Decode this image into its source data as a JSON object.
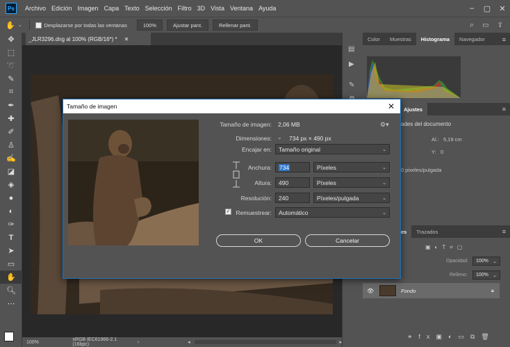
{
  "menubar": {
    "items": [
      "Archivo",
      "Edición",
      "Imagen",
      "Capa",
      "Texto",
      "Selección",
      "Filtro",
      "3D",
      "Vista",
      "Ventana",
      "Ayuda"
    ],
    "logo": "Ps"
  },
  "options": {
    "scroll_all_label": "Desplazarse por todas las ventanas",
    "zoom_label": "100%",
    "fit_label": "Ajustar pant.",
    "fill_label": "Rellenar pant."
  },
  "document": {
    "tab_title": "_JLR3296.dng al 100% (RGB/16*) *",
    "status_zoom": "100%",
    "status_profile": "sRGB IEC61966-2.1 (16bpc)"
  },
  "panels": {
    "top_tabs": [
      "Color",
      "Muestras",
      "Histograma",
      "Navegador"
    ],
    "active_top_tab": "Histograma",
    "props_tab_suffix": "Ajustes",
    "props_title_partial": "ades del documento",
    "props_al": "Al.:",
    "props_al_value": "5,19 cm",
    "props_y": "Y:",
    "props_y_value": "0",
    "props_res": "0 pixeles/pulgada",
    "layers_tabs": [
      "es",
      "Trazados"
    ],
    "opacity_label": "Opacidad:",
    "opacity_value": "100%",
    "fill_label": "Relleno:",
    "fill_value": "100%",
    "layer_name": "Fondo"
  },
  "dialog": {
    "title": "Tamaño de imagen",
    "image_size_label": "Tamaño de imagen:",
    "image_size_value": "2,06 MB",
    "dimensions_label": "Dimensiones:",
    "dimensions_value": "734 px  ×  490 px",
    "fit_label": "Encajar en:",
    "fit_value": "Tamaño original",
    "width_label": "Anchura:",
    "width_value": "734",
    "width_unit": "Píxeles",
    "height_label": "Altura:",
    "height_value": "490",
    "height_unit": "Píxeles",
    "resolution_label": "Resolución:",
    "resolution_value": "240",
    "resolution_unit": "Píxeles/pulgada",
    "resample_label": "Remuestrear:",
    "resample_value": "Automático",
    "ok_label": "OK",
    "cancel_label": "Cancelar"
  },
  "colors": {
    "accent": "#1e6fb8",
    "panel_bg": "#535353",
    "dark_bg": "#323232",
    "selection": "#2f75c8"
  }
}
